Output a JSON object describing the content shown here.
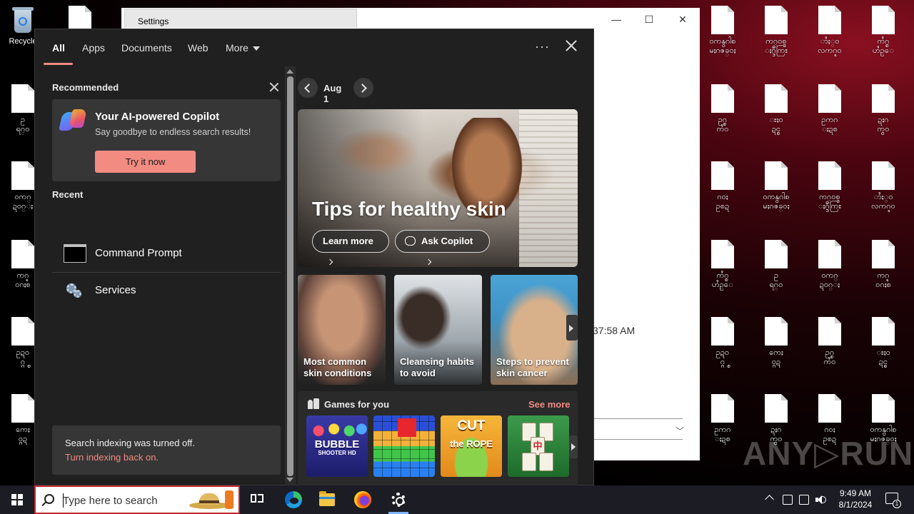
{
  "desktop": {
    "recycle_bin_label": "Recycle",
    "icons": [
      {
        "label": "ဝကနွဂါစ\nမႈဂဇခ္ဝႏ"
      },
      {
        "label": "ကဂ္ဝစ္ဒ\nႏဂ္ဒီကြႊ"
      },
      {
        "label": "ာႆႏ္ဝ\nလကဂ္ဍဝ"
      },
      {
        "label": "ကႆဂ္စ\nဟႆဥ္ေ"
      },
      {
        "label": "ဥ\nရဂ္ဝ"
      },
      {
        "label": "ဝကဂ္\nဍဝဂ္ႏ"
      },
      {
        "label": "ကဂ္ဍ\nဝဂႏစ"
      },
      {
        "label": "ဥဍဝ\nဂ္ဂ္စ"
      },
      {
        "label": "ကေႏ\nဝ္ဂဍ"
      },
      {
        "label": "ဥဂ္စ\nကႆဝ"
      },
      {
        "label": "ႊႏဝ\nဍင္စ"
      },
      {
        "label": "ဥကဂ\nႏဍစ"
      },
      {
        "label": "ဍႏဂ\nကွဝ"
      },
      {
        "label": "ဂဝႏ\nဥစဍ"
      }
    ]
  },
  "settings_window": {
    "title": "Settings",
    "time_fragment": "37:58 AM"
  },
  "search_panel": {
    "tabs": [
      {
        "label": "All"
      },
      {
        "label": "Apps"
      },
      {
        "label": "Documents"
      },
      {
        "label": "Web"
      },
      {
        "label": "More"
      }
    ],
    "more_options": "···",
    "recommended": {
      "heading": "Recommended",
      "card_title": "Your AI-powered Copilot",
      "card_subtitle": "Say goodbye to endless search results!",
      "button_label": "Try it now"
    },
    "recent": {
      "heading": "Recent",
      "items": [
        {
          "label": "Command Prompt"
        },
        {
          "label": "Services"
        }
      ]
    },
    "indexing": {
      "message": "Search indexing was turned off.",
      "link": "Turn indexing back on."
    },
    "highlights": {
      "date": "Aug 1",
      "hero_title": "Tips for healthy skin",
      "learn_more": "Learn more",
      "ask_copilot": "Ask Copilot",
      "tiles": [
        {
          "caption": "Most common skin conditions"
        },
        {
          "caption": "Cleansing habits to avoid"
        },
        {
          "caption": "Steps to prevent skin cancer"
        }
      ]
    },
    "games": {
      "title": "Games for you",
      "see_more": "See more",
      "items": [
        {
          "name": "Bubble Shooter HD",
          "logo_line1": "BUBBLE",
          "logo_line2": "SHOOTER HD"
        },
        {
          "name": "Blocks"
        },
        {
          "name": "Cut the Rope",
          "logo_line1": "CUT",
          "logo_line2": "the ROPE"
        },
        {
          "name": "Mahjong",
          "tile_glyph": "中"
        }
      ]
    }
  },
  "watermark": "ANY▷RUN",
  "taskbar": {
    "search_placeholder": "Type here to search",
    "time": "9:49 AM",
    "date": "8/1/2024",
    "notification_count": "1"
  },
  "colors": {
    "accent": "#f28b82",
    "panel_bg": "#202020",
    "card_bg": "#363636",
    "taskbar_bg": "#1c1c24"
  }
}
